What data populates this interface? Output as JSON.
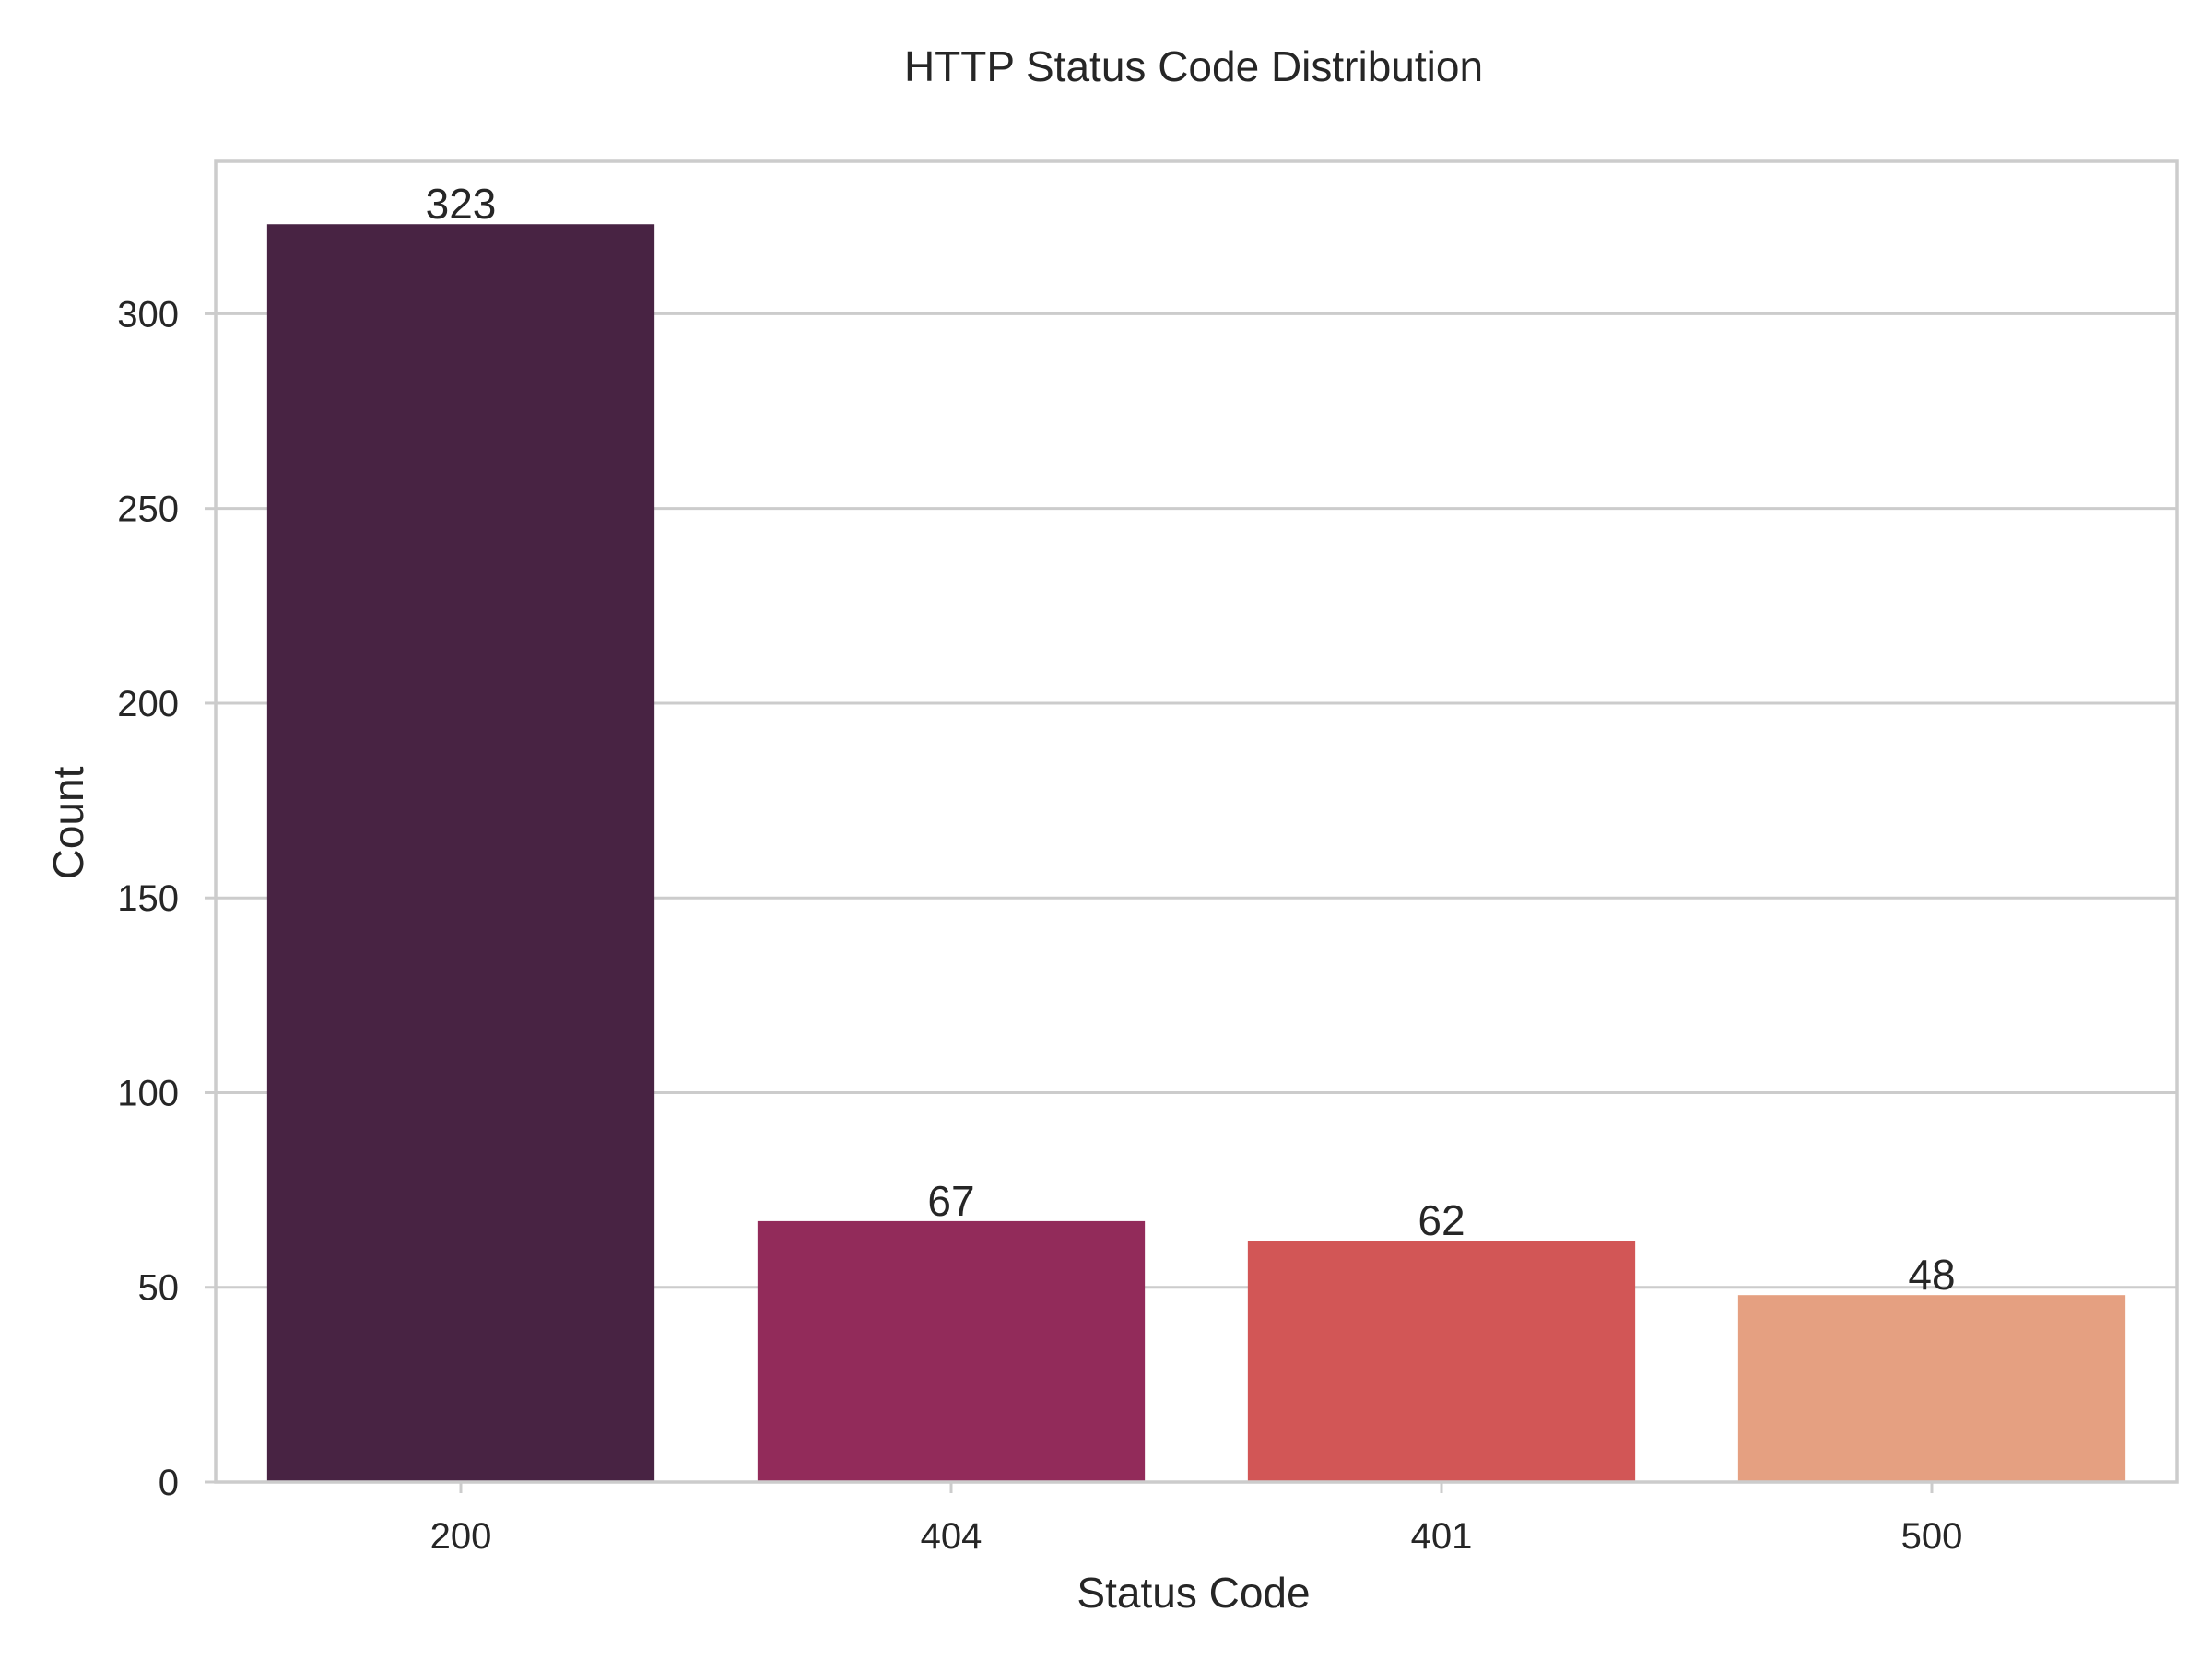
{
  "chart_data": {
    "type": "bar",
    "title": "HTTP Status Code Distribution",
    "xlabel": "Status Code",
    "ylabel": "Count",
    "categories": [
      "200",
      "404",
      "401",
      "500"
    ],
    "values": [
      323,
      67,
      62,
      48
    ],
    "data_labels": [
      "323",
      "67",
      "62",
      "48"
    ],
    "colors": [
      "#482343",
      "#922b5a",
      "#d25656",
      "#e5a081"
    ],
    "ylim": [
      0,
      339.15
    ],
    "yticks": [
      0,
      50,
      100,
      150,
      200,
      250,
      300
    ],
    "ytick_labels": [
      "0",
      "50",
      "100",
      "150",
      "200",
      "250",
      "300"
    ],
    "grid": "horizontal",
    "legend": "none"
  }
}
